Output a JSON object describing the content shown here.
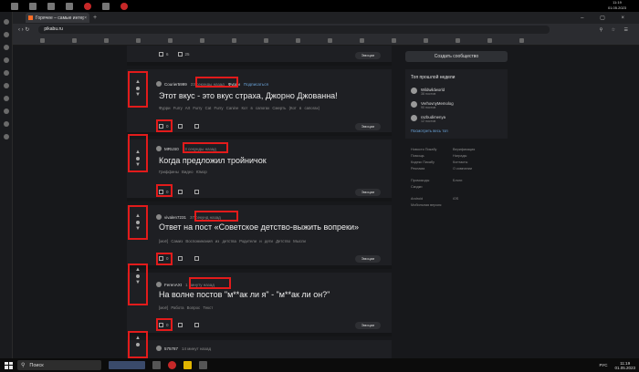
{
  "os_top": {
    "time": "11:19",
    "date": "01.05.2023"
  },
  "browser": {
    "tab_title": "Горячее – самые интерес…",
    "tab_close": "×",
    "new_tab": "+",
    "window_controls": "– ▢ ×",
    "url": "pikabu.ru",
    "nav": "‹ › ↻",
    "addr_icons": "⚲ ☆ ☰"
  },
  "right_column": {
    "create_button": "Создать сообщество",
    "top_week_title": "Топ прошлой недели",
    "top_users": [
      {
        "name": "Wildwildworld",
        "sub": "38 постов"
      },
      {
        "name": "VerhovnyMemolog",
        "sub": "90 постов"
      },
      {
        "name": "razbudimenya",
        "sub": "12 постов"
      }
    ],
    "see_all": "Посмотреть весь топ",
    "links": [
      "Новости Пикабу",
      "Верификация",
      "Помощь",
      "Награды",
      "Кодекс Пикабу",
      "Контакты",
      "Реклама",
      "О компании",
      "Промокоды",
      "Блоги",
      "Скидки",
      "",
      "Android",
      "iOS",
      "Мобильная версия",
      ""
    ]
  },
  "top_post_actions": {
    "comments": "6",
    "saves": "25",
    "emotions": "Эмоции"
  },
  "posts": [
    {
      "author": "Courier5999",
      "time": "23 секунды назад",
      "community": "Фурри",
      "subscribe": "Подписаться",
      "title": "Этот вкус - это вкус страха, Джорно Джованна!",
      "tags": "Фурри   Furry Art   Furry Cat   Furry Canine   Кот в сапогах   Смерть (Кот в сапогах)",
      "comments": "0",
      "emotions": "Эмоции"
    },
    {
      "author": "MRUS0",
      "time": "23 секунды назад",
      "title": "Когда предложил тройничок",
      "tags": "Гриффины   Видео   Юмор",
      "comments": "0",
      "emotions": "Эмоции"
    },
    {
      "author": "vivalen7231",
      "time": "37 секунд назад",
      "title": "Ответ на пост «Советское детство-выжить вопреки»",
      "tags": "[моё]   Самиз   Воспоминания из детства   Родители и дети   Детство   Мысли",
      "comments": "0",
      "emotions": "Эмоции"
    },
    {
      "author": "FerenAXt",
      "time": "1 минуту назад",
      "title": "На волне постов \"м**ак ли я\" - \"м**ак ли он?\"",
      "tags": "[моё]   Работа   Вопрос   Текст",
      "comments": "0",
      "emotions": "Эмоции"
    },
    {
      "author": "575787",
      "time": "14 минут назад",
      "title": "",
      "tags": "",
      "comments": "",
      "emotions": ""
    }
  ],
  "taskbar": {
    "search_placeholder": "Поиск",
    "lang": "РУС",
    "time": "11:19",
    "date": "01.05.2023"
  }
}
